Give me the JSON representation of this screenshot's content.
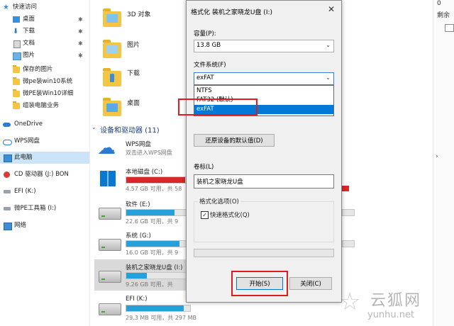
{
  "nav": {
    "items": [
      {
        "label": "快速访问",
        "icon": "star-icon",
        "pin": ""
      },
      {
        "label": "桌面",
        "icon": "desktop-icon",
        "pin": "✱"
      },
      {
        "label": "下载",
        "icon": "download-icon",
        "pin": "✱"
      },
      {
        "label": "文档",
        "icon": "document-icon",
        "pin": "✱"
      },
      {
        "label": "图片",
        "icon": "picture-icon",
        "pin": "✱"
      },
      {
        "label": "保存的图片",
        "icon": "folder-icon",
        "pin": ""
      },
      {
        "label": "微pe装win10系统",
        "icon": "folder-icon",
        "pin": ""
      },
      {
        "label": "微PE装Win10详细",
        "icon": "folder-icon",
        "pin": ""
      },
      {
        "label": "组装电脑业务",
        "icon": "folder-icon",
        "pin": ""
      },
      {
        "label": "OneDrive",
        "icon": "cloud-icon",
        "pin": ""
      },
      {
        "label": "WPS网盘",
        "icon": "wps-cloud-icon",
        "pin": ""
      },
      {
        "label": "此电脑",
        "icon": "computer-icon",
        "pin": ""
      },
      {
        "label": "CD 驱动器 (J:) BON",
        "icon": "cd-drive-icon",
        "pin": ""
      },
      {
        "label": "EFI (K:)",
        "icon": "drive-icon",
        "pin": ""
      },
      {
        "label": "微PE工具箱 (I:)",
        "icon": "drive-icon",
        "pin": ""
      },
      {
        "label": "网络",
        "icon": "network-icon",
        "pin": ""
      }
    ]
  },
  "main": {
    "folders": [
      {
        "label": "3D 对象"
      },
      {
        "label": "图片"
      },
      {
        "label": "下载"
      },
      {
        "label": "桌面"
      }
    ],
    "section_title": "设备和驱动器 (11)",
    "wps": {
      "name": "WPS网盘",
      "desc": "双击进入WPS网盘"
    },
    "drives": [
      {
        "name": "本地磁盘 (C:)",
        "info": "4.57 GB 可用，共 58",
        "fill": 0.92,
        "warn": true
      },
      {
        "name": "软件 (E:)",
        "info": "22.6 GB 可用，共 9",
        "fill": 0.76,
        "warn": false
      },
      {
        "name": "系统 (G:)",
        "info": "16.0 GB 可用，共 9",
        "fill": 0.83,
        "warn": false
      },
      {
        "name": "装机之家晓龙U盘 (I:)",
        "info": "9.26 GB 可用，共",
        "fill": 0.32,
        "warn": false
      },
      {
        "name": "EFI (K:)",
        "info": "29.3 MB 可用，共 297 MB",
        "fill": 0.9,
        "warn": false
      }
    ]
  },
  "right": {
    "text1": "0",
    "text2": "剩余"
  },
  "dialog": {
    "title": "格式化 装机之家晓龙U盘 (I:)",
    "close": "✕",
    "capacity_label": "容量(P):",
    "capacity_value": "13.8 GB",
    "fs_label": "文件系统(F)",
    "fs_value": "exFAT",
    "fs_options": [
      "NTFS",
      "FAT32 (默认)",
      "exFAT"
    ],
    "restore_button": "还原设备的默认值(D)",
    "volume_label": "卷标(L)",
    "volume_value": "装机之家晓龙U盘",
    "options_label": "格式化选项(O)",
    "quick_format_label": "快速格式化(Q)",
    "quick_format_checked": "✓",
    "start_button": "开始(S)",
    "close_button": "关闭(C)"
  },
  "watermark": {
    "text1": "云狐网",
    "text2": "yunhu.net"
  },
  "colors": {
    "accent": "#0078d7",
    "highlight": "#e11b1b",
    "usage": "#26a0da",
    "usage_warn": "#da2626"
  }
}
